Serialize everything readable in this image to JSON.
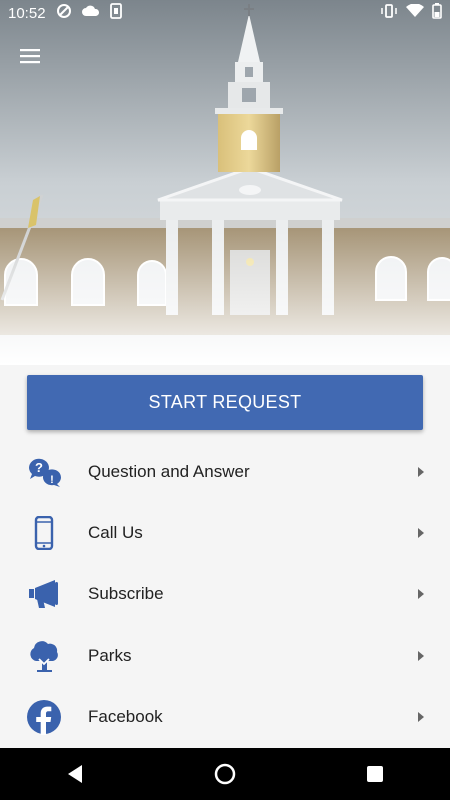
{
  "status_bar": {
    "time": "10:52"
  },
  "colors": {
    "accent": "#4169b2",
    "icon": "#3a62ad"
  },
  "start_button": {
    "label": "START REQUEST"
  },
  "menu": [
    {
      "label": "Question and Answer",
      "icon": "question-bubbles-icon"
    },
    {
      "label": "Call Us",
      "icon": "phone-icon"
    },
    {
      "label": "Subscribe",
      "icon": "megaphone-icon"
    },
    {
      "label": "Parks",
      "icon": "tree-icon"
    },
    {
      "label": "Facebook",
      "icon": "facebook-icon"
    }
  ]
}
